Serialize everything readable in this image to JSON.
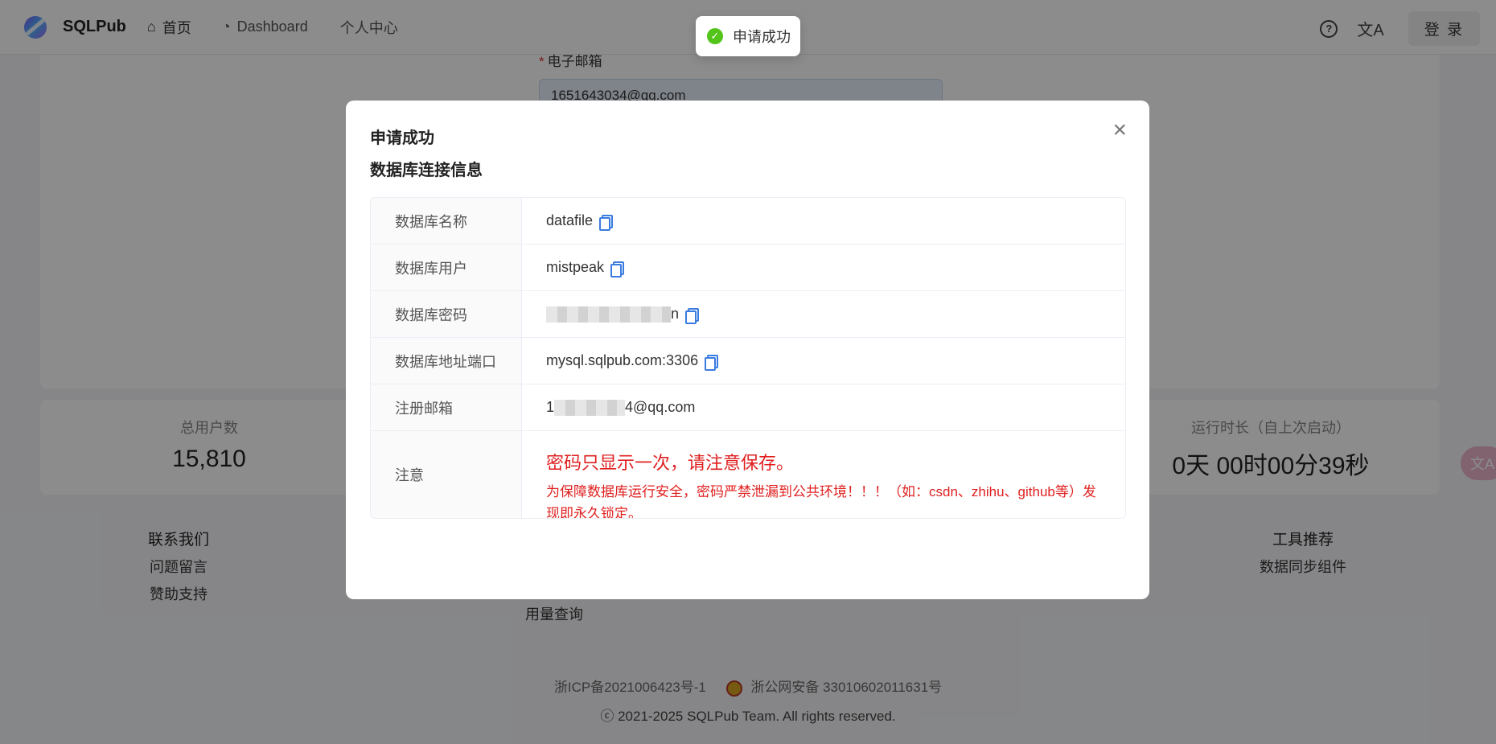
{
  "navbar": {
    "brand": "SQLPub",
    "items": [
      {
        "icon": "home-icon",
        "label": "首页"
      },
      {
        "icon": "dashboard-icon",
        "label": "Dashboard"
      },
      {
        "label": "个人中心"
      }
    ],
    "help_glyph": "?",
    "lang_glyph": "文A",
    "login_label": "登 录"
  },
  "form": {
    "email_label": "电子邮箱",
    "email_value": "1651643034@qq.com"
  },
  "stats": [
    {
      "label": "总用户数",
      "value": "15,810"
    },
    {
      "label": "运行时长（自上次启动）",
      "value": "0天 00时00分39秒"
    }
  ],
  "footer": {
    "contact": {
      "title": "联系我们",
      "links": [
        "问题留言",
        "赞助支持"
      ]
    },
    "usage_link": "用量查询",
    "tools": {
      "title": "工具推荐",
      "links": [
        "数据同步组件"
      ]
    },
    "icp": "浙ICP备2021006423号-1",
    "police": "浙公网安备 33010602011631号",
    "copyright": "ⓒ 2021-2025 SQLPub Team. All rights reserved."
  },
  "side_float_glyph": "文A",
  "toast": {
    "text": "申请成功",
    "color": "#52c41a"
  },
  "modal": {
    "title": "申请成功",
    "subtitle": "数据库连接信息",
    "close_glyph": "×",
    "rows": {
      "db_name": {
        "label": "数据库名称",
        "value": "datafile"
      },
      "db_user": {
        "label": "数据库用户",
        "value": "mistpeak"
      },
      "db_password": {
        "label": "数据库密码",
        "prefix": "",
        "suffix": "n"
      },
      "db_host": {
        "label": "数据库地址端口",
        "value": "mysql.sqlpub.com:3306"
      },
      "reg_email": {
        "label": "注册邮箱",
        "prefix": "1",
        "suffix": "4@qq.com"
      },
      "note": {
        "label": "注意",
        "big": "密码只显示一次，请注意保存。",
        "small": "为保障数据库运行安全，密码严禁泄漏到公共环境！！！（如：csdn、zhihu、github等）发现即永久锁定。"
      }
    }
  }
}
